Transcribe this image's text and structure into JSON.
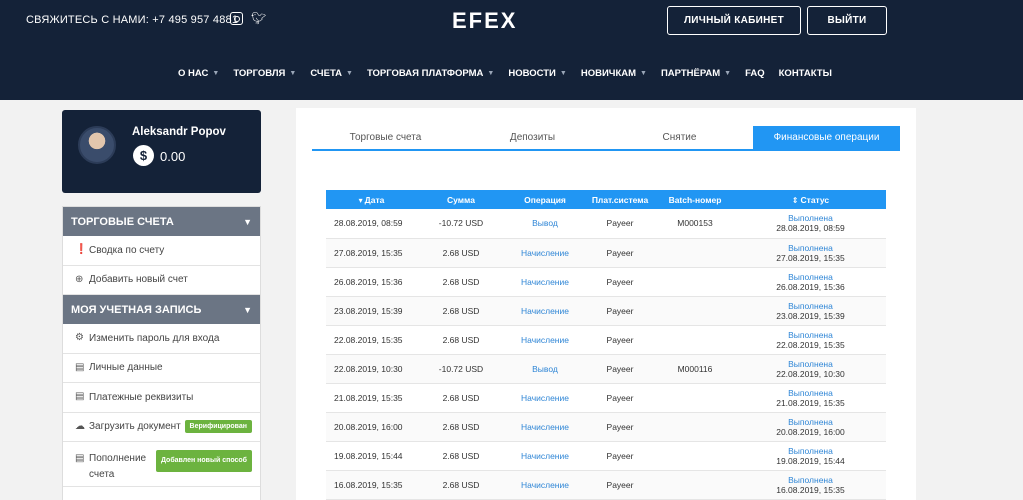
{
  "header": {
    "contact": "СВЯЖИТЕСЬ С НАМИ: +7 495 957 4881",
    "logo": "EFEX",
    "cabinet_button": "ЛИЧНЫЙ КАБИНЕТ",
    "exit_button": "ВЫЙТИ",
    "nav": [
      {
        "label": "О НАС",
        "caret": true
      },
      {
        "label": "ТОРГОВЛЯ",
        "caret": true
      },
      {
        "label": "СЧЕТА",
        "caret": true
      },
      {
        "label": "ТОРГОВАЯ ПЛАТФОРМА",
        "caret": true
      },
      {
        "label": "НОВОСТИ",
        "caret": true
      },
      {
        "label": "НОВИЧКАМ",
        "caret": true
      },
      {
        "label": "ПАРТНЁРАМ",
        "caret": true
      },
      {
        "label": "FAQ",
        "caret": false
      },
      {
        "label": "КОНТАКТЫ",
        "caret": false
      }
    ]
  },
  "profile": {
    "name": "Aleksandr Popov",
    "currency_symbol": "$",
    "balance": "0.00"
  },
  "sidebar": {
    "section1": "ТОРГОВЫЕ СЧЕТА",
    "section1_items": [
      "Сводка по счету",
      "Добавить новый счет"
    ],
    "section2": "МОЯ УЧЕТНАЯ ЗАПИСЬ",
    "section2_items": [
      "Изменить пароль для входа",
      "Личные данные",
      "Платежные реквизиты",
      "Загрузить документ",
      "Пополнение счета"
    ],
    "badge_verified": "Верифицирован",
    "badge_new": "Добавлен новый способ"
  },
  "tabs": [
    "Торговые счета",
    "Депозиты",
    "Снятие",
    "Финансовые операции"
  ],
  "table": {
    "headers": [
      "Дата",
      "Сумма",
      "Операция",
      "Плат.система",
      "Batch-номер",
      "Статус"
    ],
    "rows": [
      {
        "date": "28.08.2019, 08:59",
        "amount": "-10.72 USD",
        "op": "Вывод",
        "system": "Payeer",
        "batch": "M000153",
        "status": "Выполнена",
        "status_date": "28.08.2019, 08:59"
      },
      {
        "date": "27.08.2019, 15:35",
        "amount": "2.68 USD",
        "op": "Начисление",
        "system": "Payeer",
        "batch": "",
        "status": "Выполнена",
        "status_date": "27.08.2019, 15:35"
      },
      {
        "date": "26.08.2019, 15:36",
        "amount": "2.68 USD",
        "op": "Начисление",
        "system": "Payeer",
        "batch": "",
        "status": "Выполнена",
        "status_date": "26.08.2019, 15:36"
      },
      {
        "date": "23.08.2019, 15:39",
        "amount": "2.68 USD",
        "op": "Начисление",
        "system": "Payeer",
        "batch": "",
        "status": "Выполнена",
        "status_date": "23.08.2019, 15:39"
      },
      {
        "date": "22.08.2019, 15:35",
        "amount": "2.68 USD",
        "op": "Начисление",
        "system": "Payeer",
        "batch": "",
        "status": "Выполнена",
        "status_date": "22.08.2019, 15:35"
      },
      {
        "date": "22.08.2019, 10:30",
        "amount": "-10.72 USD",
        "op": "Вывод",
        "system": "Payeer",
        "batch": "M000116",
        "status": "Выполнена",
        "status_date": "22.08.2019, 10:30"
      },
      {
        "date": "21.08.2019, 15:35",
        "amount": "2.68 USD",
        "op": "Начисление",
        "system": "Payeer",
        "batch": "",
        "status": "Выполнена",
        "status_date": "21.08.2019, 15:35"
      },
      {
        "date": "20.08.2019, 16:00",
        "amount": "2.68 USD",
        "op": "Начисление",
        "system": "Payeer",
        "batch": "",
        "status": "Выполнена",
        "status_date": "20.08.2019, 16:00"
      },
      {
        "date": "19.08.2019, 15:44",
        "amount": "2.68 USD",
        "op": "Начисление",
        "system": "Payeer",
        "batch": "",
        "status": "Выполнена",
        "status_date": "19.08.2019, 15:44"
      },
      {
        "date": "16.08.2019, 15:35",
        "amount": "2.68 USD",
        "op": "Начисление",
        "system": "Payeer",
        "batch": "",
        "status": "Выполнена",
        "status_date": "16.08.2019, 15:35"
      }
    ]
  },
  "colors": {
    "header_bg": "#142238",
    "accent": "#2196f3",
    "badge_green": "#6cb33f",
    "menu_head": "#6b7584"
  }
}
